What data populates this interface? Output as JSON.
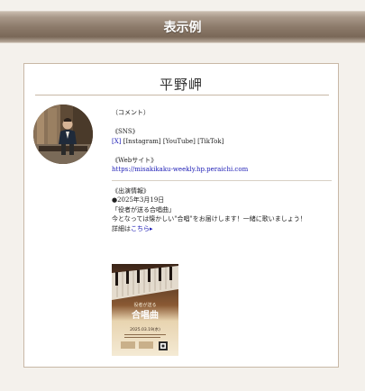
{
  "header": {
    "title": "表示例"
  },
  "profile": {
    "name": "平野岬",
    "comment": "（コメント）",
    "sns_heading": "《SNS》",
    "sns_links": [
      "[X]",
      "[Instagram]",
      "[YouTube]",
      "[TikTok]"
    ],
    "web_heading": "《Webサイト》",
    "web_url": "https://misakikaku-weekly.hp.peraichi.com",
    "event_heading": "《出演情報》",
    "event_date": "●2025年3月19日",
    "event_title": "「役者が送る合唱曲」",
    "event_desc": "今となっては懐かしい\"合唱\"をお届けします！一緒に歌いましょう！",
    "details_prefix": "詳細は",
    "details_link": "こちら▸"
  },
  "poster": {
    "subtitle": "役者が送る",
    "title": "合唱曲",
    "date": "2025.03.19(水)"
  },
  "colors": {
    "accent_blue": "#1a1ab5",
    "header_brown": "#8c7a6a",
    "border_tan": "#c8b8a6"
  }
}
